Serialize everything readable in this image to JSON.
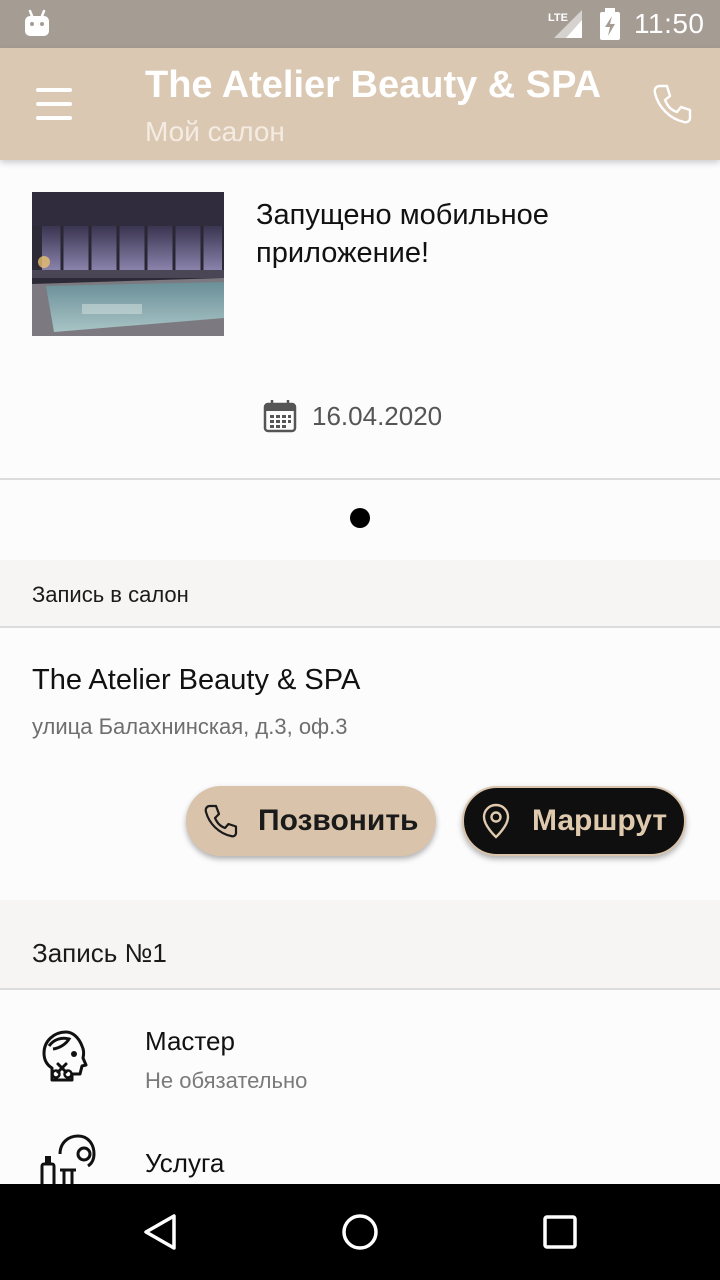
{
  "status_bar": {
    "time": "11:50",
    "network": "LTE"
  },
  "app_bar": {
    "title": "The Atelier Beauty & SPA",
    "subtitle": "Мой салон"
  },
  "news": {
    "title": "Запущено мобильное приложение!",
    "date": "16.04.2020",
    "pager": {
      "count": 1,
      "active": 1
    }
  },
  "booking_section": {
    "header": "Запись в салон"
  },
  "salon": {
    "name": "The Atelier Beauty & SPA",
    "address": "улица Балахнинская, д.3, оф.3",
    "call_label": "Позвонить",
    "route_label": "Маршрут"
  },
  "appointment": {
    "header": "Запись №1",
    "rows": [
      {
        "title": "Мастер",
        "subtitle": "Не обязательно",
        "icon": "master-icon"
      },
      {
        "title": "Услуга",
        "subtitle": "",
        "icon": "service-icon"
      }
    ]
  },
  "colors": {
    "accent": "#dbc8b2",
    "button_call": "#d9c3ab",
    "button_route": "#0f0f0f",
    "route_text": "#e0caae",
    "status_bar": "#a59c94"
  }
}
